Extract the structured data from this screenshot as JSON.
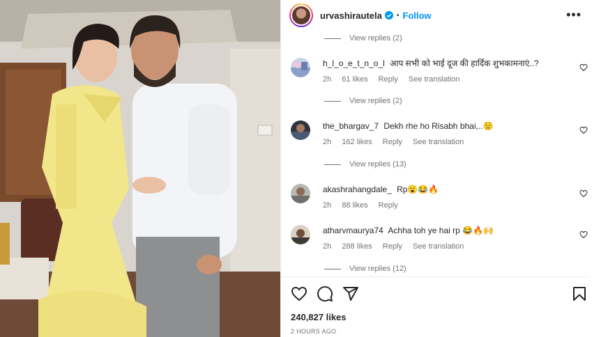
{
  "post": {
    "username": "urvashirautela",
    "follow_label": "Follow",
    "separator": "•",
    "more_label": "•••",
    "likes_count": "240,827 likes",
    "timestamp": "2 HOURS AGO"
  },
  "view_replies": [
    "View replies (2)",
    "View replies (2)",
    "View replies (13)",
    "View replies (12)"
  ],
  "comments": [
    {
      "user": "h_l_o_e_t_n_o_l",
      "text": "आप सभी को भाई दूज की हार्दिक शुभकामनाएं..?",
      "time": "2h",
      "likes": "61 likes",
      "reply": "Reply",
      "translate": "See translation"
    },
    {
      "user": "the_bhargav_7",
      "text": "Dekh rhe ho Risabh bhai,..😟",
      "time": "2h",
      "likes": "162 likes",
      "reply": "Reply",
      "translate": "See translation"
    },
    {
      "user": "akashrahangdale_",
      "text": "Rp😮😂🔥",
      "time": "2h",
      "likes": "88 likes",
      "reply": "Reply",
      "translate": ""
    },
    {
      "user": "atharvmaurya74",
      "text": "Achha toh ye hai rp 😂🔥🙌",
      "time": "2h",
      "likes": "288 likes",
      "reply": "Reply",
      "translate": "See translation"
    }
  ],
  "icons": {
    "verified": "verified-badge-icon",
    "heart": "heart-icon",
    "comment": "comment-icon",
    "share": "share-icon",
    "save": "bookmark-icon"
  },
  "colors": {
    "link_blue": "#0095f6",
    "verified_blue": "#0095f6",
    "muted_text": "#737373",
    "dress_yellow": "#f2e68a"
  }
}
